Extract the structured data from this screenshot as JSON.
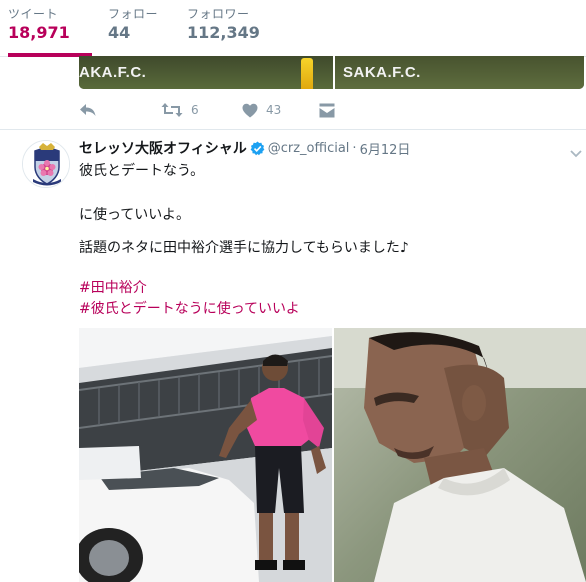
{
  "profile_nav": {
    "tweets": {
      "label": "ツイート",
      "count": "18,971"
    },
    "following": {
      "label": "フォロー",
      "count": "44"
    },
    "followers": {
      "label": "フォロワー",
      "count": "112,349"
    }
  },
  "previous_tweet": {
    "media_text_left": "AKA.F.C.",
    "media_text_right": "SAKA.F.C.",
    "retweet_count": "6",
    "like_count": "43"
  },
  "tweet": {
    "fullname": "セレッソ大阪オフィシャル",
    "username": "@crz_official",
    "separator": "·",
    "timestamp": "6月12日",
    "lines": [
      "彼氏とデートなう。",
      "に使っていいよ。",
      "話題のネタに田中裕介選手に協力してもらいました♪"
    ],
    "hashtags": [
      "#田中裕介",
      "#彼氏とデートなうに使っていいよ"
    ]
  },
  "colors": {
    "accent": "#b8005a",
    "muted": "#657786",
    "verified": "#1da1f2"
  },
  "icons": [
    "reply-icon",
    "retweet-icon",
    "heart-icon",
    "dm-icon",
    "verified-icon",
    "chevron-down-icon"
  ]
}
